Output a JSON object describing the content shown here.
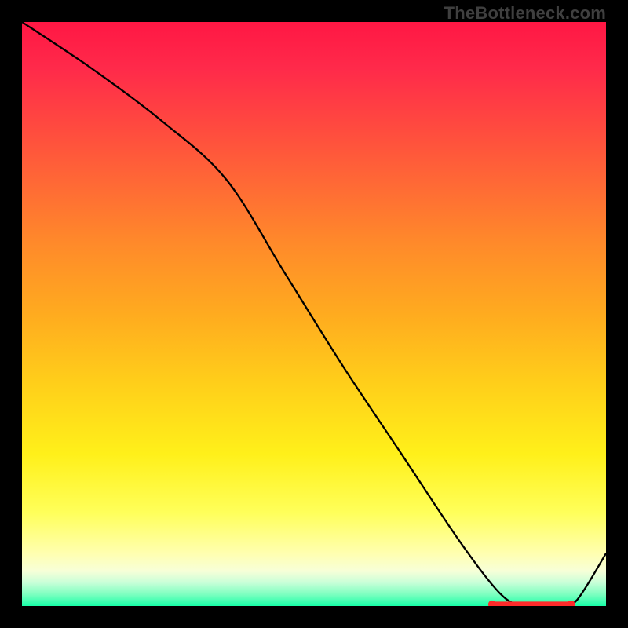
{
  "watermark": "TheBottleneck.com",
  "chart_data": {
    "type": "line",
    "title": "",
    "xlabel": "",
    "ylabel": "",
    "xlim": [
      0,
      100
    ],
    "ylim": [
      0,
      100
    ],
    "series": [
      {
        "name": "curve",
        "x": [
          0,
          12,
          24,
          35,
          45,
          55,
          65,
          75,
          82,
          86,
          89,
          92,
          95,
          100
        ],
        "y": [
          100,
          92,
          83,
          73,
          57,
          41,
          26,
          11,
          2,
          0,
          0,
          0,
          1,
          9
        ]
      }
    ],
    "markers": {
      "x": [
        80.5,
        82.0,
        83.5,
        85.0,
        86.5,
        88.0,
        89.5,
        91.0,
        92.5,
        94.0
      ],
      "y": [
        0.5,
        0.3,
        0.3,
        0.4,
        0.3,
        0.3,
        0.4,
        0.3,
        0.3,
        0.5
      ],
      "color": "#ff2a2a"
    },
    "gradient_stops": [
      {
        "p": 0,
        "c": "#ff1744"
      },
      {
        "p": 18,
        "c": "#ff4a3f"
      },
      {
        "p": 38,
        "c": "#ff8a2a"
      },
      {
        "p": 62,
        "c": "#ffcf1a"
      },
      {
        "p": 84,
        "c": "#ffff5a"
      },
      {
        "p": 94,
        "c": "#f7ffd8"
      },
      {
        "p": 100,
        "c": "#18ffa8"
      }
    ]
  }
}
